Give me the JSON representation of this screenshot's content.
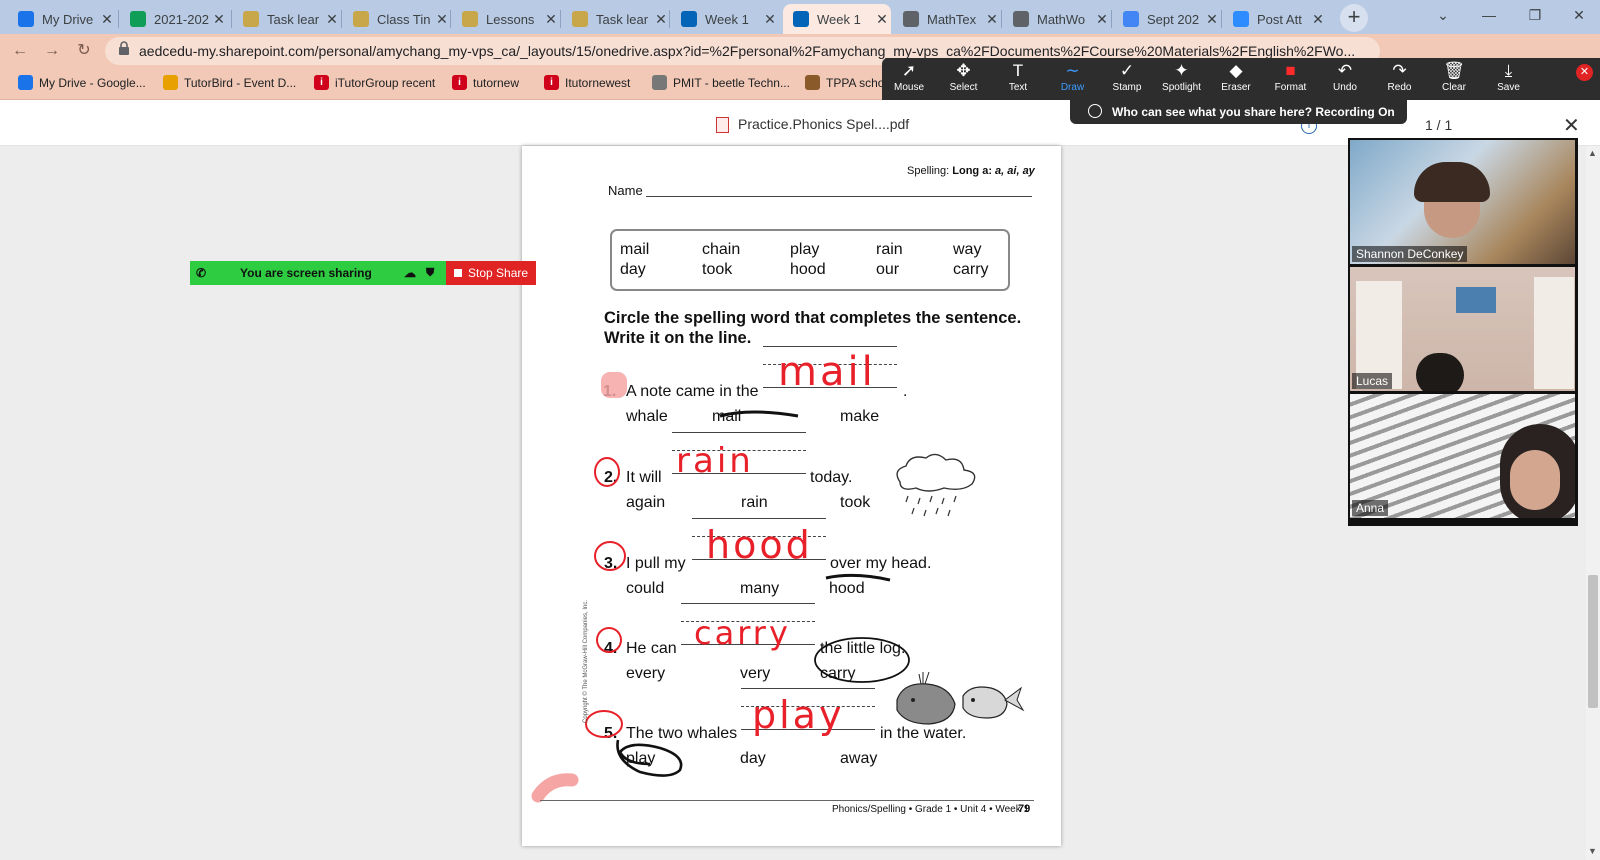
{
  "browser": {
    "tabs": [
      {
        "label": "My Drive",
        "icon": "google-drive-icon",
        "color": "#1a73e8"
      },
      {
        "label": "2021-202",
        "icon": "google-sheets-icon",
        "color": "#0f9d58"
      },
      {
        "label": "Task lear",
        "icon": "document-icon",
        "color": "#c8a64a"
      },
      {
        "label": "Class Tin",
        "icon": "document-icon",
        "color": "#c8a64a"
      },
      {
        "label": "Lessons",
        "icon": "document-icon",
        "color": "#c8a64a"
      },
      {
        "label": "Task lear",
        "icon": "document-icon",
        "color": "#c8a64a"
      },
      {
        "label": "Week 1",
        "icon": "onedrive-icon",
        "color": "#0364b8"
      },
      {
        "label": "Week 1",
        "icon": "onedrive-icon",
        "color": "#0364b8"
      },
      {
        "label": "MathTex",
        "icon": "globe-icon",
        "color": "#5f6368"
      },
      {
        "label": "MathWo",
        "icon": "globe-icon",
        "color": "#5f6368"
      },
      {
        "label": "Sept 202",
        "icon": "google-docs-icon",
        "color": "#4285f4"
      },
      {
        "label": "Post Att",
        "icon": "zoom-icon",
        "color": "#2d8cff"
      }
    ],
    "url": "aedcedu-my.sharepoint.com/personal/amychang_my-vps_ca/_layouts/15/onedrive.aspx?id=%2Fpersonal%2Famychang_my-vps_ca%2FDocuments%2FCourse%20Materials%2FEnglish%2FWo...",
    "bookmarks": [
      {
        "label": "My Drive - Google...",
        "icon": "google-drive-icon",
        "color": "#1a73e8"
      },
      {
        "label": "TutorBird - Event D...",
        "icon": "tutorbird-icon",
        "color": "#e8a000"
      },
      {
        "label": "iTutorGroup recent",
        "icon": "itutor-icon",
        "color": "#d0021b"
      },
      {
        "label": "tutornew",
        "icon": "itutor-icon",
        "color": "#d0021b"
      },
      {
        "label": "Itutornewest",
        "icon": "itutor-icon",
        "color": "#d0021b"
      },
      {
        "label": "PMIT - beetle Techn...",
        "icon": "globe-icon",
        "color": "#777777"
      },
      {
        "label": "TPPA scho",
        "icon": "tppa-icon",
        "color": "#8a5a2b"
      }
    ]
  },
  "pdf_viewer": {
    "filename": "Practice.Phonics Spel....pdf",
    "page_indicator": "1 / 1"
  },
  "zoom": {
    "tools": [
      {
        "label": "Mouse",
        "icon": "cursor-icon",
        "glyph": "➚"
      },
      {
        "label": "Select",
        "icon": "move-icon",
        "glyph": "✥"
      },
      {
        "label": "Text",
        "icon": "text-icon",
        "glyph": "T"
      },
      {
        "label": "Draw",
        "icon": "draw-icon",
        "glyph": "∼"
      },
      {
        "label": "Stamp",
        "icon": "check-icon",
        "glyph": "✓"
      },
      {
        "label": "Spotlight",
        "icon": "spotlight-icon",
        "glyph": "✦"
      },
      {
        "label": "Eraser",
        "icon": "eraser-icon",
        "glyph": "◆"
      },
      {
        "label": "Format",
        "icon": "format-icon",
        "glyph": "■"
      },
      {
        "label": "Undo",
        "icon": "undo-icon",
        "glyph": "↶"
      },
      {
        "label": "Redo",
        "icon": "redo-icon",
        "glyph": "↷"
      },
      {
        "label": "Clear",
        "icon": "trash-icon",
        "glyph": "🗑"
      },
      {
        "label": "Save",
        "icon": "save-icon",
        "glyph": "⤓"
      }
    ],
    "active_tool": "Draw",
    "recording_text": "Who can see what you share here? Recording On",
    "sharing_text": "You are screen sharing",
    "stop_share": "Stop Share",
    "participants": [
      {
        "name": "Shannon DeConkey"
      },
      {
        "name": "Lucas"
      },
      {
        "name": "Anna"
      }
    ]
  },
  "worksheet": {
    "header": "Spelling:",
    "header_bold": "Long a:",
    "header_italic": "a, ai, ay",
    "name_label": "Name",
    "word_box": [
      [
        "mail",
        "day"
      ],
      [
        "chain",
        "took"
      ],
      [
        "play",
        "hood"
      ],
      [
        "rain",
        "our"
      ],
      [
        "way",
        "carry"
      ]
    ],
    "instructions": [
      "Circle the spelling word that completes the sentence.",
      "Write it on the line."
    ],
    "items": [
      {
        "num": "1.",
        "before": "A note came in the",
        "after": ".",
        "answer": "mail",
        "choices": [
          "whale",
          "mail",
          "make"
        ]
      },
      {
        "num": "2.",
        "before": "It will",
        "after": "today.",
        "answer": "rain",
        "choices": [
          "again",
          "rain",
          "took"
        ]
      },
      {
        "num": "3.",
        "before": "I pull my",
        "after": "over my head.",
        "answer": "hood",
        "choices": [
          "could",
          "many",
          "hood"
        ]
      },
      {
        "num": "4.",
        "before": "He can",
        "after": "the little log.",
        "answer": "carry",
        "choices": [
          "every",
          "very",
          "carry"
        ]
      },
      {
        "num": "5.",
        "before": "The two whales",
        "after": "in the water.",
        "answer": "play",
        "choices": [
          "play",
          "day",
          "away"
        ]
      }
    ],
    "copyright": "Copyright © The McGraw-Hill Companies, Inc.",
    "footer": "Phonics/Spelling • Grade 1 • Unit 4 • Week 1",
    "page_number": "79"
  },
  "colors": {
    "tab_strip": "#b9cbe4",
    "address_bar": "#f1c9b6",
    "ink_red": "#e8202a",
    "zoom_green": "#2ecc40",
    "zoom_red": "#e02424"
  }
}
